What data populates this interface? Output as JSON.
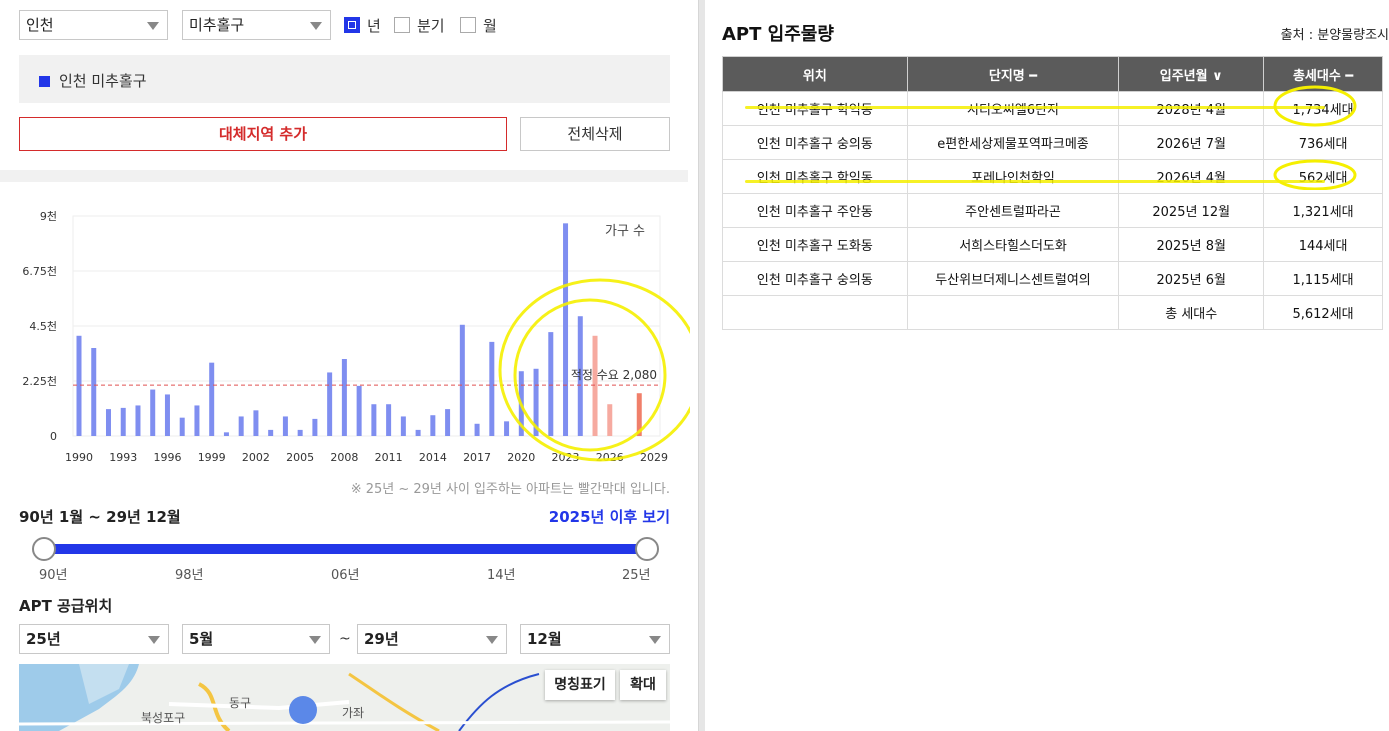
{
  "controls": {
    "region": "인천",
    "district": "미추홀구",
    "period_options": [
      {
        "label": "년",
        "checked": true
      },
      {
        "label": "분기",
        "checked": false
      },
      {
        "label": "월",
        "checked": false
      }
    ]
  },
  "selected_region": "인천 미추홀구",
  "buttons": {
    "add_region": "대체지역 추가",
    "delete_all": "전체삭제"
  },
  "chart_data": {
    "type": "bar",
    "y_unit_label": "가구 수",
    "ylim": [
      0,
      9000
    ],
    "y_ticks": [
      "0",
      "2.25천",
      "4.5천",
      "6.75천",
      "9천"
    ],
    "x_tick_labels": [
      "1990",
      "1993",
      "1996",
      "1999",
      "2002",
      "2005",
      "2008",
      "2011",
      "2014",
      "2017",
      "2020",
      "2023",
      "2026",
      "2029"
    ],
    "categories": [
      "1990",
      "1991",
      "1992",
      "1993",
      "1994",
      "1995",
      "1996",
      "1997",
      "1998",
      "1999",
      "2000",
      "2001",
      "2002",
      "2003",
      "2004",
      "2005",
      "2006",
      "2007",
      "2008",
      "2009",
      "2010",
      "2011",
      "2012",
      "2013",
      "2014",
      "2015",
      "2016",
      "2017",
      "2018",
      "2019",
      "2020",
      "2021",
      "2022",
      "2023",
      "2024",
      "2025",
      "2026",
      "2027",
      "2028",
      "2029"
    ],
    "values": [
      4100,
      3600,
      1100,
      1150,
      1250,
      1900,
      1700,
      750,
      1250,
      3000,
      150,
      800,
      1050,
      250,
      800,
      250,
      700,
      2600,
      3150,
      2050,
      1300,
      1300,
      800,
      250,
      850,
      1100,
      4550,
      500,
      3850,
      600,
      2650,
      2750,
      4250,
      8700,
      4900,
      4100,
      1300,
      0,
      1750,
      0
    ],
    "future_from": "2025",
    "reference_line": {
      "value": 2080,
      "label": "적정 수요 2,080"
    },
    "colors": {
      "past": "#7f8ef0",
      "future": "#f6aaa0",
      "future_dark": "#f07f6a",
      "reference": "#e05050"
    }
  },
  "chart_note": "※ 25년 ~ 29년 사이 입주하는 아파트는 빨간막대 입니다.",
  "range": {
    "title": "90년 1월 ~ 29년 12월",
    "link": "2025년 이후 보기",
    "ticks": [
      "90년",
      "98년",
      "06년",
      "14년",
      "25년"
    ]
  },
  "supply": {
    "title": "APT 공급위치",
    "from_year": "25년",
    "from_month": "5월",
    "to_year": "29년",
    "to_month": "12월",
    "separator": "~"
  },
  "map": {
    "label_button": "명칭표기",
    "zoom_button": "확대",
    "labels": [
      "동구",
      "북성포구",
      "가좌"
    ]
  },
  "table": {
    "title": "APT 입주물량",
    "source": "출처 : 분양물량조시",
    "headers": [
      "위치",
      "단지명 ━",
      "입주년월 ∨",
      "총세대수 ━"
    ],
    "rows": [
      [
        "인천 미추홀구 학익동",
        "시티오씨엘6단지",
        "2028년 4월",
        "1,734세대"
      ],
      [
        "인천 미추홀구 숭의동",
        "e편한세상제물포역파크메종",
        "2026년 7월",
        "736세대"
      ],
      [
        "인천 미추홀구 학익동",
        "포레나인천학익",
        "2026년 4월",
        "562세대"
      ],
      [
        "인천 미추홀구 주안동",
        "주안센트럴파라곤",
        "2025년 12월",
        "1,321세대"
      ],
      [
        "인천 미추홀구 도화동",
        "서희스타힐스더도화",
        "2025년 8월",
        "144세대"
      ],
      [
        "인천 미추홀구 숭의동",
        "두산위브더제니스센트럴여의",
        "2025년 6월",
        "1,115세대"
      ]
    ],
    "total_label": "총 세대수",
    "total_value": "5,612세대"
  }
}
